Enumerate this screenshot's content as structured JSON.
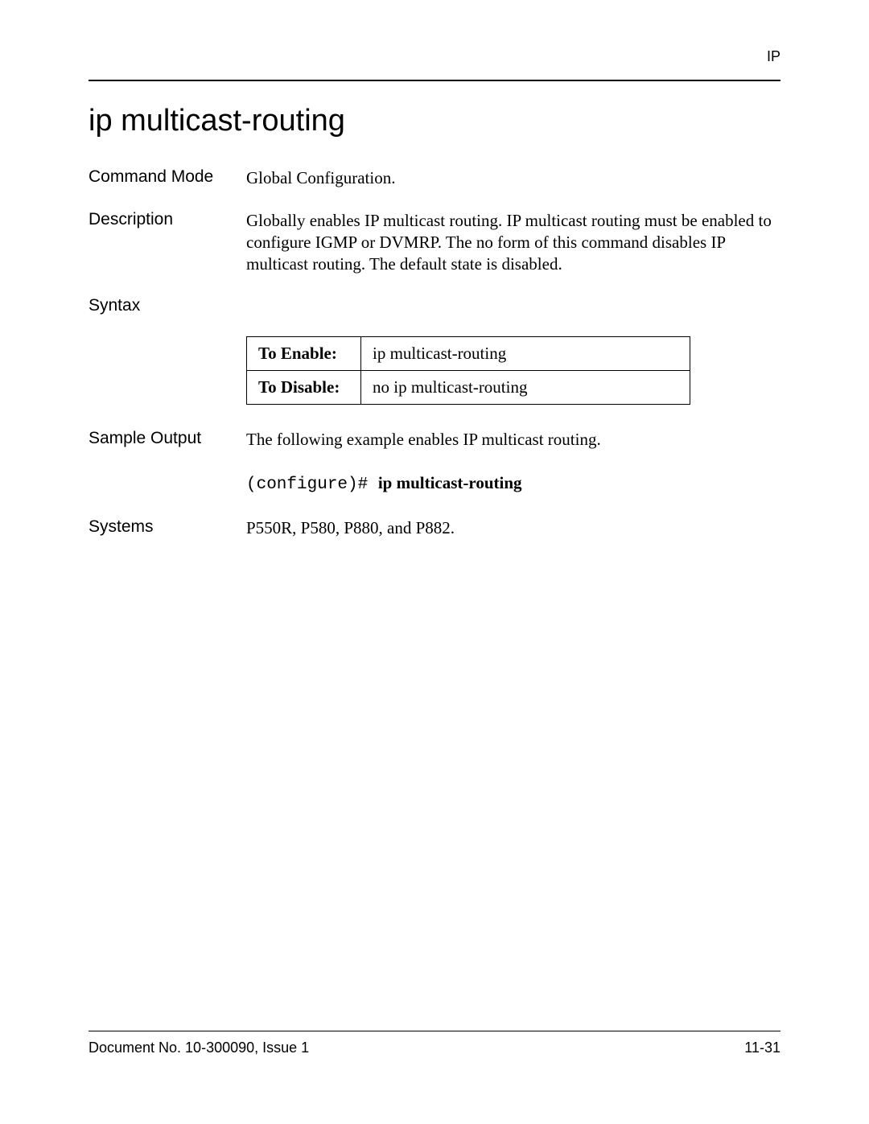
{
  "header": {
    "tag": "IP"
  },
  "title": "ip multicast-routing",
  "sections": {
    "commandMode": {
      "label": "Command Mode",
      "value": "Global Configuration."
    },
    "description": {
      "label": "Description",
      "value": "Globally enables IP multicast routing. IP multicast routing must be enabled to configure IGMP or DVMRP. The no form of this command disables IP multicast routing. The default state is disabled."
    },
    "syntax": {
      "label": "Syntax",
      "rows": [
        {
          "header": "To Enable:",
          "value": "ip multicast-routing"
        },
        {
          "header": "To Disable:",
          "value": "no ip multicast-routing"
        }
      ]
    },
    "sampleOutput": {
      "label": "Sample Output",
      "intro": "The following example enables IP multicast routing.",
      "prompt": "(configure)# ",
      "command": "ip multicast-routing"
    },
    "systems": {
      "label": "Systems",
      "value": "P550R, P580, P880, and P882."
    }
  },
  "footer": {
    "left": "Document No. 10-300090, Issue 1",
    "right": "11-31"
  }
}
